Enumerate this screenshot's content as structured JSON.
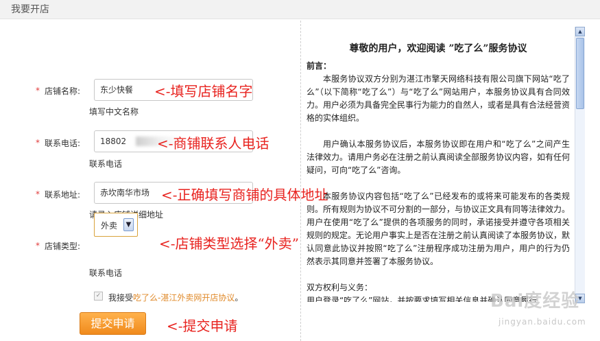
{
  "header": {
    "title": "我要开店"
  },
  "form": {
    "required_mark": "*",
    "shop_name": {
      "label": "店铺名称:",
      "value": "东少快餐",
      "hint": "填写中文名称"
    },
    "phone": {
      "label": "联系电话:",
      "value": "18802",
      "hint": "联系电话"
    },
    "address": {
      "label": "联系地址:",
      "value": "赤坎南华市场",
      "hint": "请录入店铺详细地址"
    },
    "shop_type": {
      "label": "店铺类型:",
      "selected": "外卖",
      "hint": "联系电话"
    },
    "agree": {
      "checked": true,
      "text": "我接受",
      "link": "吃了么-湛江外卖网开店协议",
      "suffix": "。"
    },
    "submit_label": "提交申请"
  },
  "annotations": {
    "name": "<-填写店铺名字",
    "phone": "<-商铺联系人电话",
    "address": "<-正确填写商铺的具体地址",
    "type": "<-店铺类型选择“外卖”",
    "submit": "<-提交申请"
  },
  "agreement": {
    "title": "尊敬的用户，欢迎阅读 ”吃了么”服务协议",
    "preface_label": "前言：",
    "p1": "本服务协议双方分别为湛江市擎天网络科技有限公司旗下网站“吃了么”（以下简称“吃了么”）与“吃了么”网站用户，本服务协议具有合同效力。用户必须为具备完全民事行为能力的自然人，或者是具有合法经营资格的实体组织。",
    "p2": "用户确认本服务协议后，本服务协议即在用户和“吃了么”之间产生法律效力。请用户务必在注册之前认真阅读全部服务协议内容，如有任何疑问，可向“吃了么”咨询。",
    "p3": "本服务协议内容包括“吃了么”已经发布的或将来可能发布的各类规则。所有规则为协议不可分割的一部分，与协议正文具有同等法律效力。用户在使用“吃了么”提供的各项服务的同时，承诺接受并遵守各项相关规则的规定。无论用户事实上是否在注册之前认真阅读了本服务协议，默认同意此协议并按照“吃了么”注册程序成功注册为用户，用户的行为仍然表示其同意并签署了本服务协议。",
    "section2_label": "双方权利与义务：",
    "p4": "用户登录“吃了么”网站，并按要求填写相关信息并确认同意履行"
  },
  "watermark": {
    "text": "Bai度经验",
    "url": "jingyan.baidu.com"
  }
}
